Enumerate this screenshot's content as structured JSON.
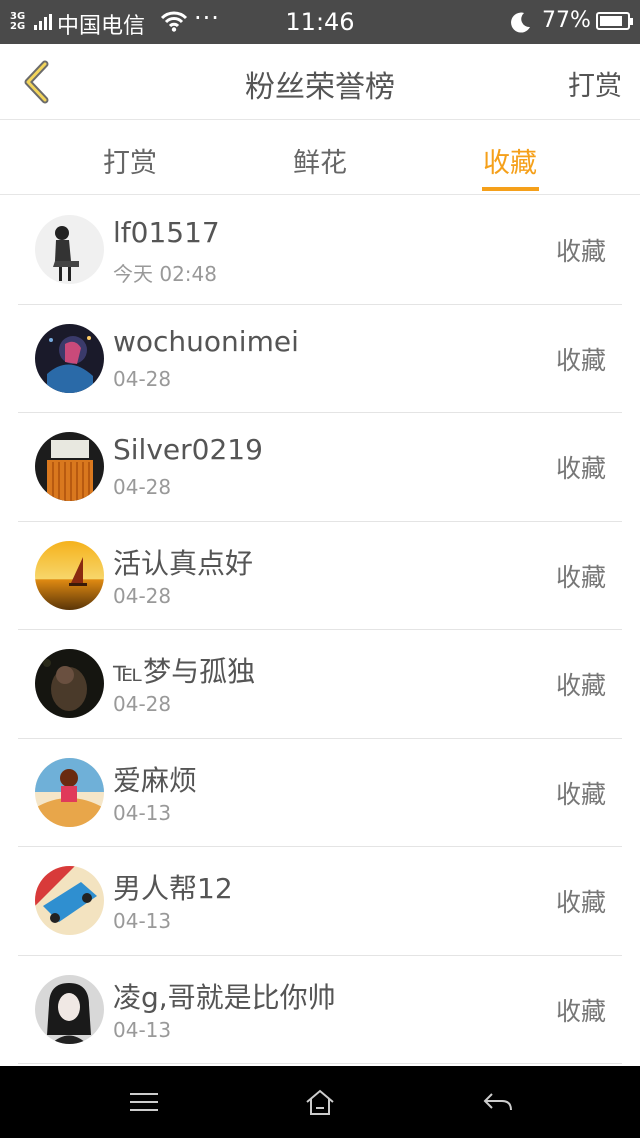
{
  "status_bar": {
    "network": "3G 2G",
    "carrier": "中国电信",
    "dots": "···",
    "time": "11:46",
    "battery": "77%",
    "battery_level": 0.77
  },
  "header": {
    "title": "粉丝荣誉榜",
    "action": "打赏"
  },
  "tabs": [
    {
      "label": "打赏",
      "active": false
    },
    {
      "label": "鲜花",
      "active": false
    },
    {
      "label": "收藏",
      "active": true
    }
  ],
  "accent_color": "#f5a01a",
  "list": [
    {
      "name": "lf01517",
      "time": "今天 02:48",
      "action": "收藏"
    },
    {
      "name": "wochuonimei",
      "time": "04-28",
      "action": "收藏"
    },
    {
      "name": "Silver0219",
      "time": "04-28",
      "action": "收藏"
    },
    {
      "name": "活认真点好",
      "time": "04-28",
      "action": "收藏"
    },
    {
      "name": "℡梦与孤独",
      "time": "04-28",
      "action": "收藏"
    },
    {
      "name": "爱麻烦",
      "time": "04-13",
      "action": "收藏"
    },
    {
      "name": "男人帮12",
      "time": "04-13",
      "action": "收藏"
    },
    {
      "name": "凌g,哥就是比你帅",
      "time": "04-13",
      "action": "收藏"
    }
  ]
}
